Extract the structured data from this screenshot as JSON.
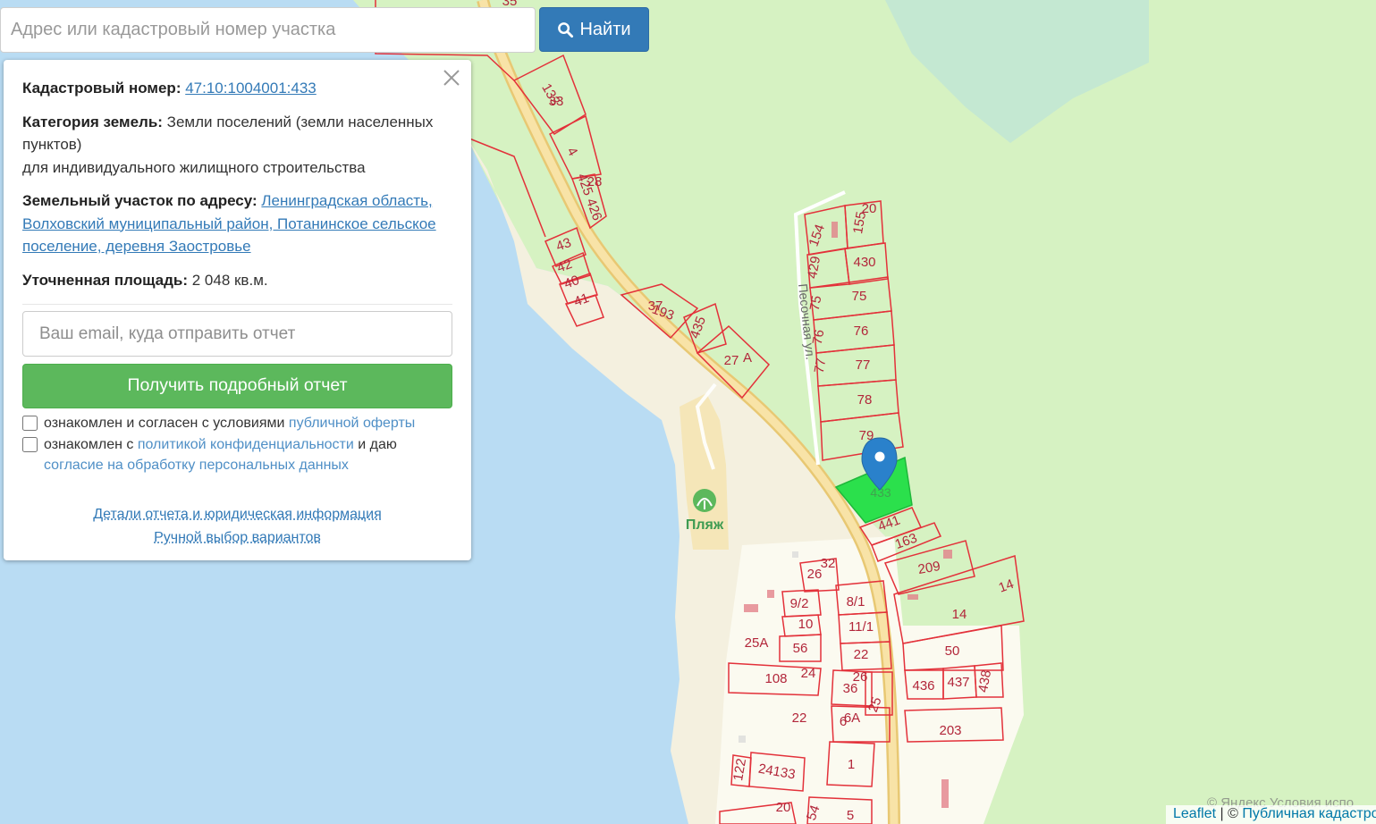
{
  "search": {
    "placeholder": "Адрес или кадастровый номер участка",
    "button_label": "Найти"
  },
  "panel": {
    "cadastral_label": "Кадастровый номер:",
    "cadastral_number": "47:10:1004001:433",
    "category_label": "Категория земель:",
    "category_value_line1": "Земли поселений (земли населенных пунктов)",
    "category_value_line2": "для индивидуального жилищного строительства",
    "address_label": "Земельный участок по адресу:",
    "address_link": "Ленинградская область, Волховский муниципальный район, Потанинское сельское поселение, деревня Заостровье",
    "area_label": "Уточненная площадь:",
    "area_value": "2 048 кв.м.",
    "email_placeholder": "Ваш email, куда отправить отчет",
    "report_button": "Получить подробный отчет",
    "consent1_prefix": "ознакомлен и согласен с условиями",
    "consent1_link": "публичной оферты",
    "consent2_prefix": "ознакомлен с",
    "consent2_link": "политикой конфиденциальности",
    "consent2_middle": "и даю",
    "consent2_link2": "согласие на обработку персональных данных",
    "details_link": "Детали отчета и юридическая информация",
    "manual_link": "Ручной выбор вариантов"
  },
  "map": {
    "water_color": "#b9dcf3",
    "forest_color": "#d6f2c2",
    "settlement_color": "#fbfaf0",
    "road_color": "#f6dd9e",
    "parcel_border_color": "#e3313a",
    "selected_parcel_color": "#2be04c",
    "marker_color": "#2a81cb",
    "street_label": "Песочная ул.",
    "beach_label": "Пляж",
    "selected_parcel_label": "433",
    "parcel_labels": [
      "133",
      "33",
      "4",
      "425",
      "426",
      "28",
      "43",
      "42",
      "40",
      "41",
      "193",
      "37",
      "435",
      "27",
      "А",
      "154",
      "155",
      "20",
      "429",
      "430",
      "75",
      "75",
      "76",
      "76",
      "77",
      "77",
      "78",
      "79",
      "441",
      "163",
      "209",
      "14",
      "14",
      "26",
      "32",
      "9/2",
      "8/1",
      "10",
      "11/1",
      "56",
      "25А",
      "22",
      "108",
      "24",
      "36",
      "26",
      "25",
      "6А",
      "6",
      "50",
      "436",
      "437",
      "438",
      "203",
      "22",
      "1",
      "122",
      "24133",
      "20",
      "54",
      "5",
      "35"
    ]
  },
  "attribution": {
    "leaflet": "Leaflet",
    "separator": "| ©",
    "source": "Публичная кадастровая карта",
    "yandex": "© Яндекс  Условия испо"
  }
}
